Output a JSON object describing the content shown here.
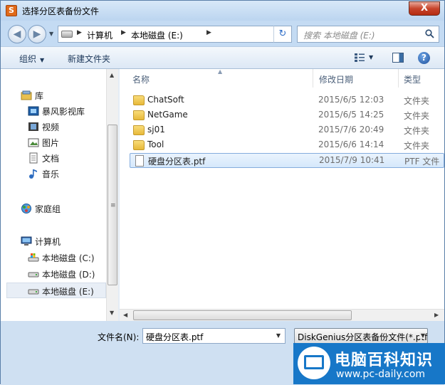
{
  "window": {
    "title": "选择分区表备份文件",
    "app_icon": "S",
    "close_label": "X"
  },
  "address": {
    "crumbs": [
      "计算机",
      "本地磁盘 (E:)"
    ]
  },
  "search": {
    "placeholder": "搜索 本地磁盘 (E:)"
  },
  "toolbar": {
    "organize_label": "组织",
    "new_folder_label": "新建文件夹"
  },
  "nav": {
    "libraries": {
      "label": "库",
      "items": [
        "暴风影视库",
        "视频",
        "图片",
        "文档",
        "音乐"
      ]
    },
    "homegroup": {
      "label": "家庭组"
    },
    "computer": {
      "label": "计算机",
      "drives": [
        "本地磁盘 (C:)",
        "本地磁盘 (D:)",
        "本地磁盘 (E:)"
      ]
    },
    "selected": "本地磁盘 (E:)"
  },
  "columns": {
    "name": "名称",
    "date": "修改日期",
    "type": "类型"
  },
  "files": [
    {
      "name": "ChatSoft",
      "date": "2015/6/5 12:03",
      "type": "文件夹",
      "kind": "folder"
    },
    {
      "name": "NetGame",
      "date": "2015/6/5 14:25",
      "type": "文件夹",
      "kind": "folder"
    },
    {
      "name": "sj01",
      "date": "2015/7/6 20:49",
      "type": "文件夹",
      "kind": "folder"
    },
    {
      "name": "Tool",
      "date": "2015/6/6 14:14",
      "type": "文件夹",
      "kind": "folder"
    },
    {
      "name": "硬盘分区表.ptf",
      "date": "2015/7/9 10:41",
      "type": "PTF 文件",
      "kind": "file"
    }
  ],
  "selected_file": "硬盘分区表.ptf",
  "bottom": {
    "filename_label": "文件名(N):",
    "filename_value": "硬盘分区表.ptf",
    "filetype_value": "DiskGenius分区表备份文件(*.ptf)"
  },
  "watermark": {
    "title": "电脑百科知识",
    "url": "www.pc-daily.com"
  },
  "colors": {
    "accent": "#1777c8",
    "selection": "#d5e8fb",
    "frame": "#c4dbf3"
  }
}
